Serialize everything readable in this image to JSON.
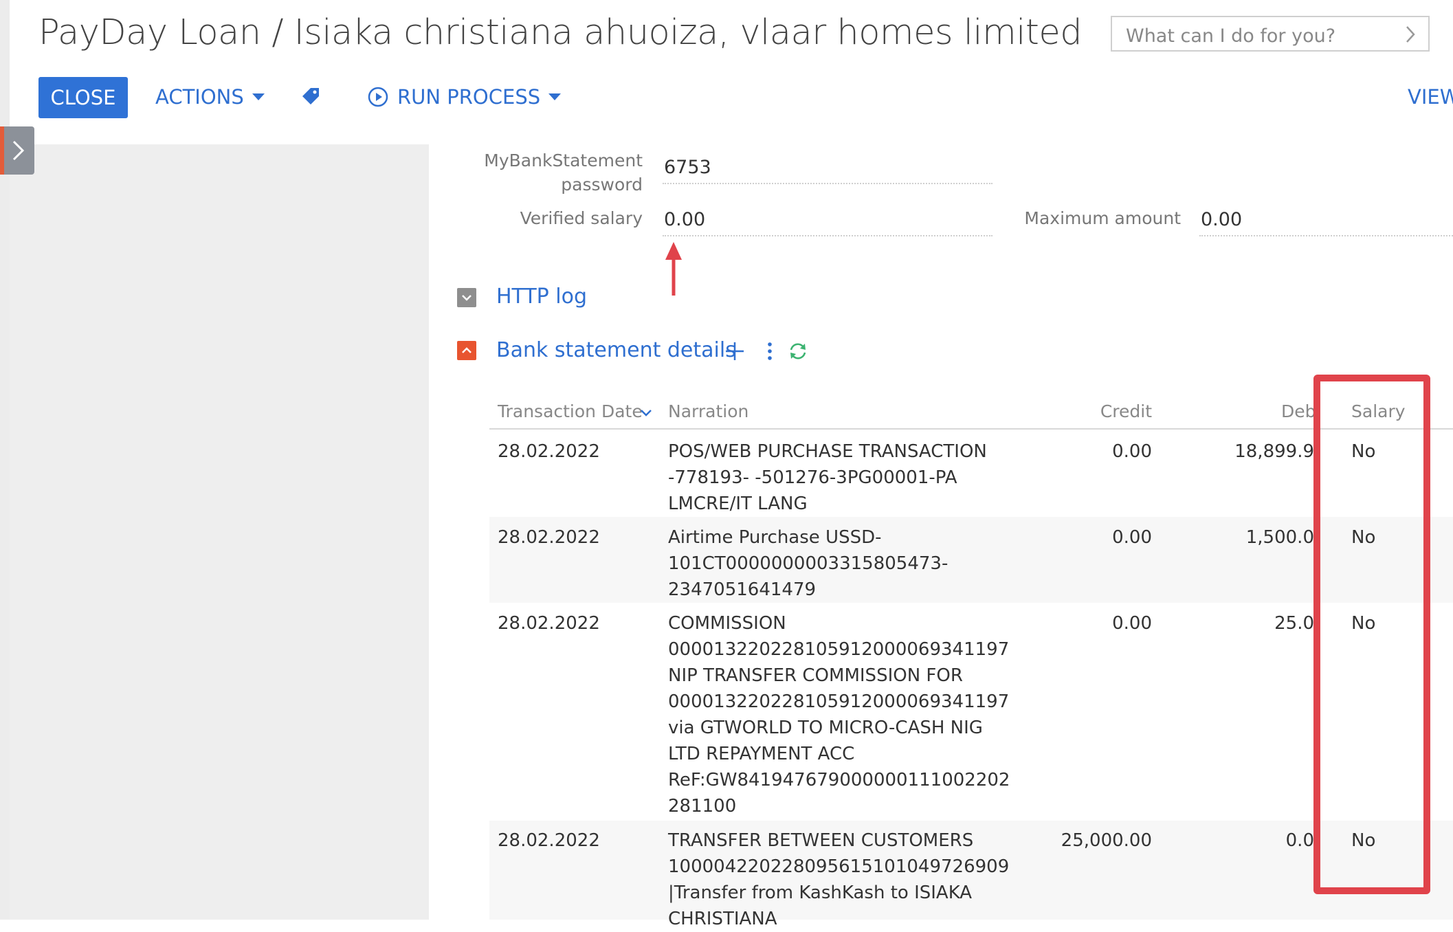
{
  "header": {
    "title": "PayDay Loan / Isiaka christiana ahuoiza, vlaar homes limited",
    "search_placeholder": "What can I do for you?"
  },
  "toolbar": {
    "close_label": "CLOSE",
    "actions_label": "ACTIONS",
    "run_process_label": "RUN PROCESS",
    "view_label": "VIEW"
  },
  "form": {
    "mbs_password_label_line1": "MyBankStatement",
    "mbs_password_label_line2": "password",
    "mbs_password_value": "6753",
    "verified_salary_label": "Verified salary",
    "verified_salary_value": "0.00",
    "maximum_amount_label": "Maximum amount",
    "maximum_amount_value": "0.00"
  },
  "sections": {
    "http_log": "HTTP log",
    "bank_statement": "Bank statement details"
  },
  "table": {
    "columns": {
      "date": "Transaction Date",
      "narration": "Narration",
      "credit": "Credit",
      "debit": "Debi",
      "salary": "Salary"
    },
    "rows": [
      {
        "date": "28.02.2022",
        "narration": [
          "POS/WEB PURCHASE TRANSACTION",
          "-778193- -501276-3PG00001-PA",
          "LMCRE/IT LANG"
        ],
        "credit": "0.00",
        "debit": "18,899.9",
        "salary": "No"
      },
      {
        "date": "28.02.2022",
        "narration": [
          "Airtime Purchase USSD-",
          "101CT0000000003315805473-",
          "2347051641479"
        ],
        "credit": "0.00",
        "debit": "1,500.0",
        "salary": "No"
      },
      {
        "date": "28.02.2022",
        "narration": [
          "COMMISSION",
          "000013220228105912000069341197",
          "NIP TRANSFER COMMISSION FOR",
          "000013220228105912000069341197",
          "via GTWORLD TO MICRO-CASH NIG",
          "LTD REPAYMENT ACC",
          "ReF:GW841947679000000111002202",
          "281100"
        ],
        "credit": "0.00",
        "debit": "25.0",
        "salary": "No"
      },
      {
        "date": "28.02.2022",
        "narration": [
          "TRANSFER BETWEEN CUSTOMERS",
          "100004220228095615101049726909",
          "|Transfer from KashKash to ISIAKA",
          "CHRISTIANA"
        ],
        "credit": "25,000.00",
        "debit": "0.0",
        "salary": "No"
      }
    ]
  },
  "colors": {
    "accent_blue": "#2f72d6",
    "link_blue": "#2f6fd0",
    "highlight_red": "#e0434b",
    "collapse_orange": "#e8542f",
    "refresh_green": "#3cb371"
  }
}
